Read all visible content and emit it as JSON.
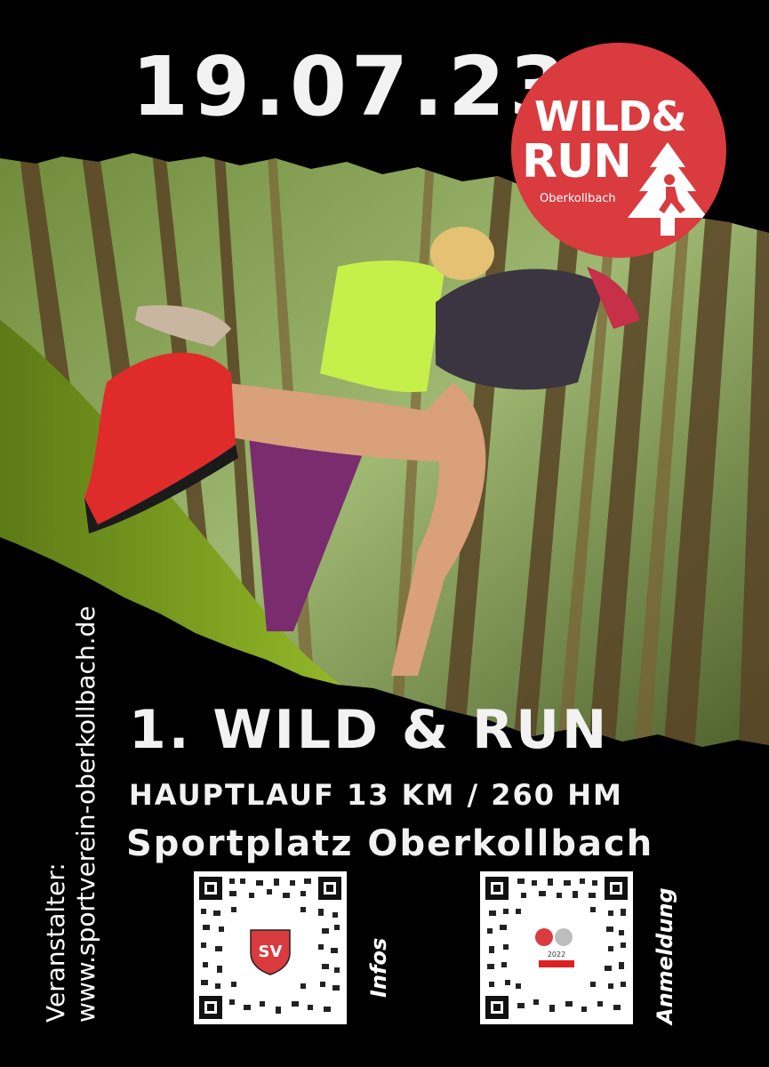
{
  "event": {
    "date": "19.07.23",
    "title": "1. WILD & RUN",
    "main_race": "HAUPTLAUF 13 KM / 260 HM",
    "venue": "Sportplatz Oberkollbach"
  },
  "logo": {
    "line1": "WILD&",
    "line2": "RUN",
    "place": "Oberkollbach",
    "color": "#d93b3f"
  },
  "organizer": {
    "label": "Veranstalter:",
    "url": "www.sportverein-oberkollbach.de"
  },
  "qr_codes": [
    {
      "label": "Infos",
      "badge": "SV"
    },
    {
      "label": "Anmeldung",
      "badge": "2022"
    }
  ],
  "colors": {
    "background": "#000000",
    "accent": "#d93b3f",
    "text": "#f2f2f2"
  }
}
